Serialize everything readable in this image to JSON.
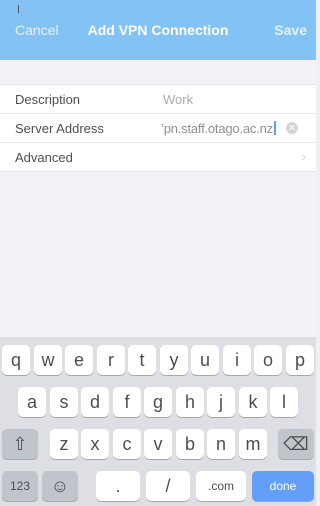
{
  "nav": {
    "cancel": "Cancel",
    "title": "Add VPN Connection",
    "save": "Save"
  },
  "rows": [
    {
      "label": "Description",
      "value": "Work"
    },
    {
      "label": "Server Address",
      "value": "vpn.staff.otago.ac.nz",
      "display": "’pn.staff.otago.ac.nz"
    },
    {
      "label": "Advanced"
    }
  ],
  "keyboard": {
    "row1": [
      "q",
      "w",
      "e",
      "r",
      "t",
      "y",
      "u",
      "i",
      "o",
      "p"
    ],
    "row2": [
      "a",
      "s",
      "d",
      "f",
      "g",
      "h",
      "j",
      "k",
      "l"
    ],
    "row3": [
      "z",
      "x",
      "c",
      "v",
      "b",
      "n",
      "m"
    ],
    "numbers": "123",
    "period": ".",
    "slash": "/",
    "dotcom": ".com",
    "done": "done",
    "shift_glyph": "⇧",
    "delete_glyph": "⌫",
    "emoji_glyph": "☺"
  },
  "colors": {
    "nav": "#5aaef0",
    "done": "#2f7ef6",
    "keyboard_bg": "#d3d5db"
  }
}
